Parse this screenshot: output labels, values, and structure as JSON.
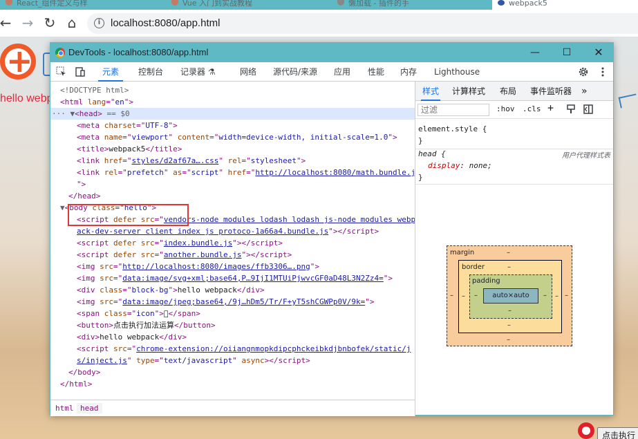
{
  "browser": {
    "tabs": [
      {
        "label": "React_组件定义与样"
      },
      {
        "label": "Vue 入门到实战教程"
      },
      {
        "label": "懒加载 - 插件的手"
      },
      {
        "label": "webpack5"
      }
    ],
    "url": "localhost:8080/app.html"
  },
  "page": {
    "hello": "hello webp",
    "button": "点击执行"
  },
  "devtools": {
    "title": "DevTools - localhost:8080/app.html",
    "tabs": [
      "元素",
      "控制台",
      "记录器 ⚗",
      "网络",
      "源代码/来源",
      "应用",
      "性能",
      "内存",
      "Lighthouse"
    ],
    "breadcrumbs": [
      "html",
      "head"
    ],
    "styles": {
      "tabs": [
        "样式",
        "计算样式",
        "布局",
        "事件监听器",
        "»"
      ],
      "filter_placeholder": "过滤",
      "hov": ":hov",
      "cls": ".cls",
      "rule1_selector": "element.style {",
      "rule1_close": "}",
      "rule2_selector": "head {",
      "rule2_source": "用户代理样式表",
      "rule2_prop": "display",
      "rule2_value": "none;",
      "rule2_close": "}"
    },
    "boxmodel": {
      "margin": "margin",
      "border": "border",
      "padding": "padding",
      "content": "auto×auto",
      "dash": "–"
    }
  }
}
